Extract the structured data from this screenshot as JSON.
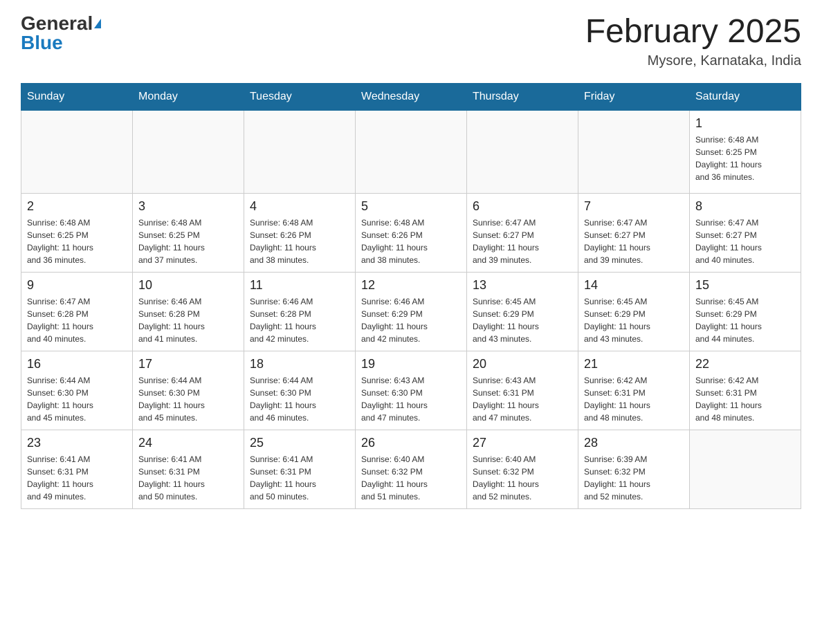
{
  "header": {
    "logo_general": "General",
    "logo_blue": "Blue",
    "title": "February 2025",
    "subtitle": "Mysore, Karnataka, India"
  },
  "days_of_week": [
    "Sunday",
    "Monday",
    "Tuesday",
    "Wednesday",
    "Thursday",
    "Friday",
    "Saturday"
  ],
  "weeks": [
    [
      {
        "day": "",
        "info": ""
      },
      {
        "day": "",
        "info": ""
      },
      {
        "day": "",
        "info": ""
      },
      {
        "day": "",
        "info": ""
      },
      {
        "day": "",
        "info": ""
      },
      {
        "day": "",
        "info": ""
      },
      {
        "day": "1",
        "info": "Sunrise: 6:48 AM\nSunset: 6:25 PM\nDaylight: 11 hours\nand 36 minutes."
      }
    ],
    [
      {
        "day": "2",
        "info": "Sunrise: 6:48 AM\nSunset: 6:25 PM\nDaylight: 11 hours\nand 36 minutes."
      },
      {
        "day": "3",
        "info": "Sunrise: 6:48 AM\nSunset: 6:25 PM\nDaylight: 11 hours\nand 37 minutes."
      },
      {
        "day": "4",
        "info": "Sunrise: 6:48 AM\nSunset: 6:26 PM\nDaylight: 11 hours\nand 38 minutes."
      },
      {
        "day": "5",
        "info": "Sunrise: 6:48 AM\nSunset: 6:26 PM\nDaylight: 11 hours\nand 38 minutes."
      },
      {
        "day": "6",
        "info": "Sunrise: 6:47 AM\nSunset: 6:27 PM\nDaylight: 11 hours\nand 39 minutes."
      },
      {
        "day": "7",
        "info": "Sunrise: 6:47 AM\nSunset: 6:27 PM\nDaylight: 11 hours\nand 39 minutes."
      },
      {
        "day": "8",
        "info": "Sunrise: 6:47 AM\nSunset: 6:27 PM\nDaylight: 11 hours\nand 40 minutes."
      }
    ],
    [
      {
        "day": "9",
        "info": "Sunrise: 6:47 AM\nSunset: 6:28 PM\nDaylight: 11 hours\nand 40 minutes."
      },
      {
        "day": "10",
        "info": "Sunrise: 6:46 AM\nSunset: 6:28 PM\nDaylight: 11 hours\nand 41 minutes."
      },
      {
        "day": "11",
        "info": "Sunrise: 6:46 AM\nSunset: 6:28 PM\nDaylight: 11 hours\nand 42 minutes."
      },
      {
        "day": "12",
        "info": "Sunrise: 6:46 AM\nSunset: 6:29 PM\nDaylight: 11 hours\nand 42 minutes."
      },
      {
        "day": "13",
        "info": "Sunrise: 6:45 AM\nSunset: 6:29 PM\nDaylight: 11 hours\nand 43 minutes."
      },
      {
        "day": "14",
        "info": "Sunrise: 6:45 AM\nSunset: 6:29 PM\nDaylight: 11 hours\nand 43 minutes."
      },
      {
        "day": "15",
        "info": "Sunrise: 6:45 AM\nSunset: 6:29 PM\nDaylight: 11 hours\nand 44 minutes."
      }
    ],
    [
      {
        "day": "16",
        "info": "Sunrise: 6:44 AM\nSunset: 6:30 PM\nDaylight: 11 hours\nand 45 minutes."
      },
      {
        "day": "17",
        "info": "Sunrise: 6:44 AM\nSunset: 6:30 PM\nDaylight: 11 hours\nand 45 minutes."
      },
      {
        "day": "18",
        "info": "Sunrise: 6:44 AM\nSunset: 6:30 PM\nDaylight: 11 hours\nand 46 minutes."
      },
      {
        "day": "19",
        "info": "Sunrise: 6:43 AM\nSunset: 6:30 PM\nDaylight: 11 hours\nand 47 minutes."
      },
      {
        "day": "20",
        "info": "Sunrise: 6:43 AM\nSunset: 6:31 PM\nDaylight: 11 hours\nand 47 minutes."
      },
      {
        "day": "21",
        "info": "Sunrise: 6:42 AM\nSunset: 6:31 PM\nDaylight: 11 hours\nand 48 minutes."
      },
      {
        "day": "22",
        "info": "Sunrise: 6:42 AM\nSunset: 6:31 PM\nDaylight: 11 hours\nand 48 minutes."
      }
    ],
    [
      {
        "day": "23",
        "info": "Sunrise: 6:41 AM\nSunset: 6:31 PM\nDaylight: 11 hours\nand 49 minutes."
      },
      {
        "day": "24",
        "info": "Sunrise: 6:41 AM\nSunset: 6:31 PM\nDaylight: 11 hours\nand 50 minutes."
      },
      {
        "day": "25",
        "info": "Sunrise: 6:41 AM\nSunset: 6:31 PM\nDaylight: 11 hours\nand 50 minutes."
      },
      {
        "day": "26",
        "info": "Sunrise: 6:40 AM\nSunset: 6:32 PM\nDaylight: 11 hours\nand 51 minutes."
      },
      {
        "day": "27",
        "info": "Sunrise: 6:40 AM\nSunset: 6:32 PM\nDaylight: 11 hours\nand 52 minutes."
      },
      {
        "day": "28",
        "info": "Sunrise: 6:39 AM\nSunset: 6:32 PM\nDaylight: 11 hours\nand 52 minutes."
      },
      {
        "day": "",
        "info": ""
      }
    ]
  ]
}
